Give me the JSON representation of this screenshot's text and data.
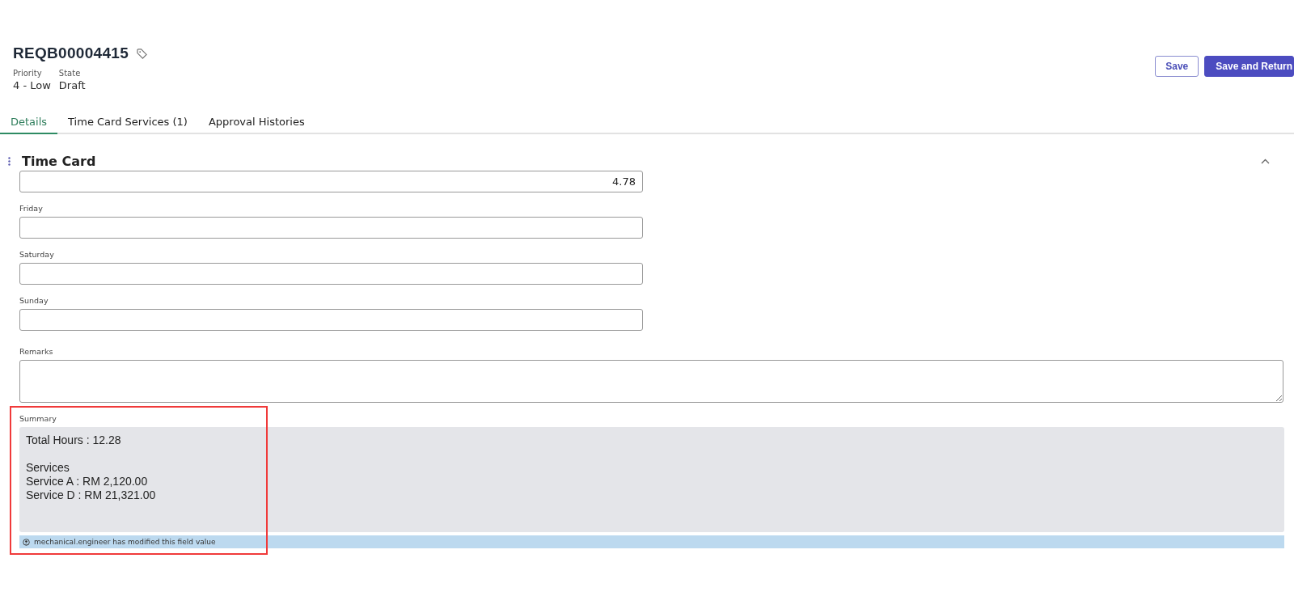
{
  "header": {
    "title": "REQB00004415",
    "meta": [
      {
        "label": "Priority",
        "value": "4 - Low"
      },
      {
        "label": "State",
        "value": "Draft"
      }
    ],
    "buttons": [
      {
        "label": "Save",
        "kind": "secondary"
      },
      {
        "label": "Save and Return",
        "kind": "primary"
      }
    ]
  },
  "tabs": [
    {
      "label": "Details",
      "selected": true
    },
    {
      "label": "Time Card Services (1)",
      "selected": false
    },
    {
      "label": "Approval Histories",
      "selected": false
    }
  ],
  "section": {
    "title": "Time Card",
    "expanded": true,
    "fields": [
      {
        "kind": "number",
        "value": "4.78"
      },
      {
        "kind": "number",
        "label": "Friday"
      },
      {
        "kind": "number",
        "label": "Saturday"
      },
      {
        "kind": "number",
        "label": "Sunday"
      },
      {
        "kind": "textarea",
        "label": "Remarks"
      }
    ],
    "summary": {
      "label": "Summary",
      "paragraphs": [
        [
          "Total Hours : 12.28"
        ],
        [
          "Services",
          "Service A : RM 2,120.00",
          "Service D : RM 21,321.00"
        ]
      ],
      "notice": "mechanical.engineer has modified this field value",
      "highlighted": true
    }
  }
}
